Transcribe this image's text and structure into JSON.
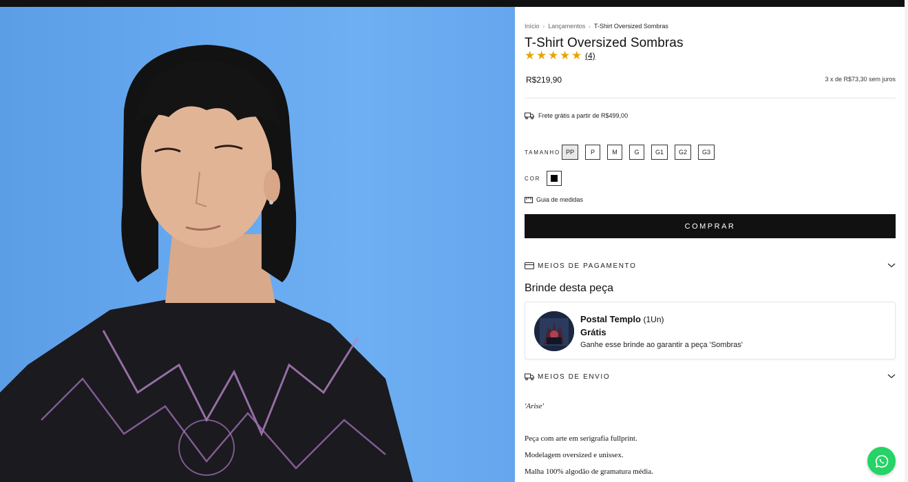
{
  "breadcrumb": {
    "items": [
      "Início",
      "Lançamentos",
      "T-Shirt Oversized Sombras"
    ]
  },
  "product": {
    "title": "T-Shirt Oversized Sombras",
    "rating_stars": 5,
    "review_count": "(4)",
    "price": "R$219,90",
    "installments": "3 x de R$73,30 sem juros",
    "shipping_note": "Frete grátis a partir de R$499,00"
  },
  "options": {
    "size_label": "TAMANHO",
    "sizes": [
      "PP",
      "P",
      "M",
      "G",
      "G1",
      "G2",
      "G3"
    ],
    "selected_size": "PP",
    "color_label": "COR",
    "selected_color": "#000000",
    "size_guide": "Guia de medidas"
  },
  "buy_button": "COMPRAR",
  "accordions": {
    "payment": "MEIOS DE PAGAMENTO",
    "shipping": "MEIOS DE ENVIO"
  },
  "gift": {
    "section_title": "Brinde desta peça",
    "name": "Postal Templo",
    "qty": "(1Un)",
    "price": "Grátis",
    "description": "Ganhe esse brinde ao garantir a peça 'Sombras'"
  },
  "description": {
    "tagline": "'Arise'",
    "lines": [
      "Peça com arte em serigrafia fullprint.",
      "Modelagem oversized e unissex.",
      "Malha 100% algodão de gramatura média."
    ]
  },
  "colors": {
    "star": "#e8a400",
    "button": "#111111",
    "whatsapp": "#25d366",
    "photo_background": "#6aaaf0"
  }
}
